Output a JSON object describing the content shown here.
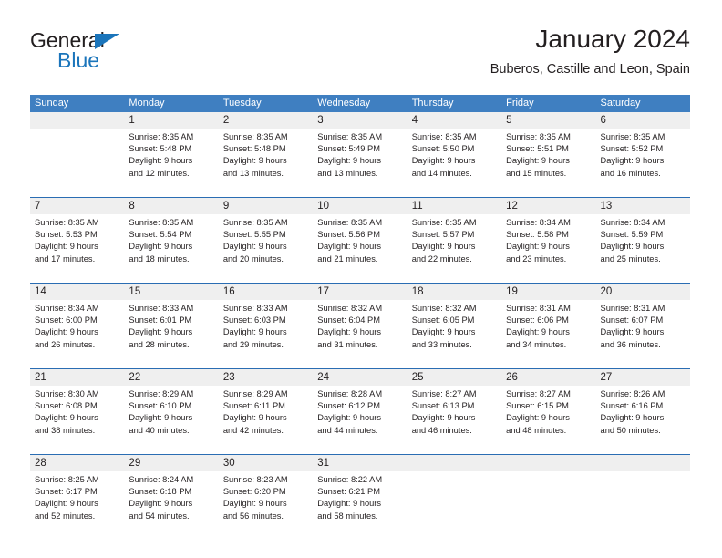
{
  "brand": {
    "name_part1": "General",
    "name_part2": "Blue",
    "triangle_color": "#1b75bb",
    "text_color": "#231f20"
  },
  "header": {
    "title": "January 2024",
    "subtitle": "Buberos, Castille and Leon, Spain"
  },
  "theme": {
    "header_bg": "#3f7fc1",
    "header_text": "#ffffff",
    "row_separator": "#2a6db3",
    "daynum_band": "#efefef",
    "cell_bg": "#ffffff"
  },
  "weekdays": [
    "Sunday",
    "Monday",
    "Tuesday",
    "Wednesday",
    "Thursday",
    "Friday",
    "Saturday"
  ],
  "weeks": [
    [
      {
        "day": "",
        "sunrise": "",
        "sunset": "",
        "daylight1": "",
        "daylight2": ""
      },
      {
        "day": "1",
        "sunrise": "Sunrise: 8:35 AM",
        "sunset": "Sunset: 5:48 PM",
        "daylight1": "Daylight: 9 hours",
        "daylight2": "and 12 minutes."
      },
      {
        "day": "2",
        "sunrise": "Sunrise: 8:35 AM",
        "sunset": "Sunset: 5:48 PM",
        "daylight1": "Daylight: 9 hours",
        "daylight2": "and 13 minutes."
      },
      {
        "day": "3",
        "sunrise": "Sunrise: 8:35 AM",
        "sunset": "Sunset: 5:49 PM",
        "daylight1": "Daylight: 9 hours",
        "daylight2": "and 13 minutes."
      },
      {
        "day": "4",
        "sunrise": "Sunrise: 8:35 AM",
        "sunset": "Sunset: 5:50 PM",
        "daylight1": "Daylight: 9 hours",
        "daylight2": "and 14 minutes."
      },
      {
        "day": "5",
        "sunrise": "Sunrise: 8:35 AM",
        "sunset": "Sunset: 5:51 PM",
        "daylight1": "Daylight: 9 hours",
        "daylight2": "and 15 minutes."
      },
      {
        "day": "6",
        "sunrise": "Sunrise: 8:35 AM",
        "sunset": "Sunset: 5:52 PM",
        "daylight1": "Daylight: 9 hours",
        "daylight2": "and 16 minutes."
      }
    ],
    [
      {
        "day": "7",
        "sunrise": "Sunrise: 8:35 AM",
        "sunset": "Sunset: 5:53 PM",
        "daylight1": "Daylight: 9 hours",
        "daylight2": "and 17 minutes."
      },
      {
        "day": "8",
        "sunrise": "Sunrise: 8:35 AM",
        "sunset": "Sunset: 5:54 PM",
        "daylight1": "Daylight: 9 hours",
        "daylight2": "and 18 minutes."
      },
      {
        "day": "9",
        "sunrise": "Sunrise: 8:35 AM",
        "sunset": "Sunset: 5:55 PM",
        "daylight1": "Daylight: 9 hours",
        "daylight2": "and 20 minutes."
      },
      {
        "day": "10",
        "sunrise": "Sunrise: 8:35 AM",
        "sunset": "Sunset: 5:56 PM",
        "daylight1": "Daylight: 9 hours",
        "daylight2": "and 21 minutes."
      },
      {
        "day": "11",
        "sunrise": "Sunrise: 8:35 AM",
        "sunset": "Sunset: 5:57 PM",
        "daylight1": "Daylight: 9 hours",
        "daylight2": "and 22 minutes."
      },
      {
        "day": "12",
        "sunrise": "Sunrise: 8:34 AM",
        "sunset": "Sunset: 5:58 PM",
        "daylight1": "Daylight: 9 hours",
        "daylight2": "and 23 minutes."
      },
      {
        "day": "13",
        "sunrise": "Sunrise: 8:34 AM",
        "sunset": "Sunset: 5:59 PM",
        "daylight1": "Daylight: 9 hours",
        "daylight2": "and 25 minutes."
      }
    ],
    [
      {
        "day": "14",
        "sunrise": "Sunrise: 8:34 AM",
        "sunset": "Sunset: 6:00 PM",
        "daylight1": "Daylight: 9 hours",
        "daylight2": "and 26 minutes."
      },
      {
        "day": "15",
        "sunrise": "Sunrise: 8:33 AM",
        "sunset": "Sunset: 6:01 PM",
        "daylight1": "Daylight: 9 hours",
        "daylight2": "and 28 minutes."
      },
      {
        "day": "16",
        "sunrise": "Sunrise: 8:33 AM",
        "sunset": "Sunset: 6:03 PM",
        "daylight1": "Daylight: 9 hours",
        "daylight2": "and 29 minutes."
      },
      {
        "day": "17",
        "sunrise": "Sunrise: 8:32 AM",
        "sunset": "Sunset: 6:04 PM",
        "daylight1": "Daylight: 9 hours",
        "daylight2": "and 31 minutes."
      },
      {
        "day": "18",
        "sunrise": "Sunrise: 8:32 AM",
        "sunset": "Sunset: 6:05 PM",
        "daylight1": "Daylight: 9 hours",
        "daylight2": "and 33 minutes."
      },
      {
        "day": "19",
        "sunrise": "Sunrise: 8:31 AM",
        "sunset": "Sunset: 6:06 PM",
        "daylight1": "Daylight: 9 hours",
        "daylight2": "and 34 minutes."
      },
      {
        "day": "20",
        "sunrise": "Sunrise: 8:31 AM",
        "sunset": "Sunset: 6:07 PM",
        "daylight1": "Daylight: 9 hours",
        "daylight2": "and 36 minutes."
      }
    ],
    [
      {
        "day": "21",
        "sunrise": "Sunrise: 8:30 AM",
        "sunset": "Sunset: 6:08 PM",
        "daylight1": "Daylight: 9 hours",
        "daylight2": "and 38 minutes."
      },
      {
        "day": "22",
        "sunrise": "Sunrise: 8:29 AM",
        "sunset": "Sunset: 6:10 PM",
        "daylight1": "Daylight: 9 hours",
        "daylight2": "and 40 minutes."
      },
      {
        "day": "23",
        "sunrise": "Sunrise: 8:29 AM",
        "sunset": "Sunset: 6:11 PM",
        "daylight1": "Daylight: 9 hours",
        "daylight2": "and 42 minutes."
      },
      {
        "day": "24",
        "sunrise": "Sunrise: 8:28 AM",
        "sunset": "Sunset: 6:12 PM",
        "daylight1": "Daylight: 9 hours",
        "daylight2": "and 44 minutes."
      },
      {
        "day": "25",
        "sunrise": "Sunrise: 8:27 AM",
        "sunset": "Sunset: 6:13 PM",
        "daylight1": "Daylight: 9 hours",
        "daylight2": "and 46 minutes."
      },
      {
        "day": "26",
        "sunrise": "Sunrise: 8:27 AM",
        "sunset": "Sunset: 6:15 PM",
        "daylight1": "Daylight: 9 hours",
        "daylight2": "and 48 minutes."
      },
      {
        "day": "27",
        "sunrise": "Sunrise: 8:26 AM",
        "sunset": "Sunset: 6:16 PM",
        "daylight1": "Daylight: 9 hours",
        "daylight2": "and 50 minutes."
      }
    ],
    [
      {
        "day": "28",
        "sunrise": "Sunrise: 8:25 AM",
        "sunset": "Sunset: 6:17 PM",
        "daylight1": "Daylight: 9 hours",
        "daylight2": "and 52 minutes."
      },
      {
        "day": "29",
        "sunrise": "Sunrise: 8:24 AM",
        "sunset": "Sunset: 6:18 PM",
        "daylight1": "Daylight: 9 hours",
        "daylight2": "and 54 minutes."
      },
      {
        "day": "30",
        "sunrise": "Sunrise: 8:23 AM",
        "sunset": "Sunset: 6:20 PM",
        "daylight1": "Daylight: 9 hours",
        "daylight2": "and 56 minutes."
      },
      {
        "day": "31",
        "sunrise": "Sunrise: 8:22 AM",
        "sunset": "Sunset: 6:21 PM",
        "daylight1": "Daylight: 9 hours",
        "daylight2": "and 58 minutes."
      },
      {
        "day": "",
        "sunrise": "",
        "sunset": "",
        "daylight1": "",
        "daylight2": ""
      },
      {
        "day": "",
        "sunrise": "",
        "sunset": "",
        "daylight1": "",
        "daylight2": ""
      },
      {
        "day": "",
        "sunrise": "",
        "sunset": "",
        "daylight1": "",
        "daylight2": ""
      }
    ]
  ]
}
